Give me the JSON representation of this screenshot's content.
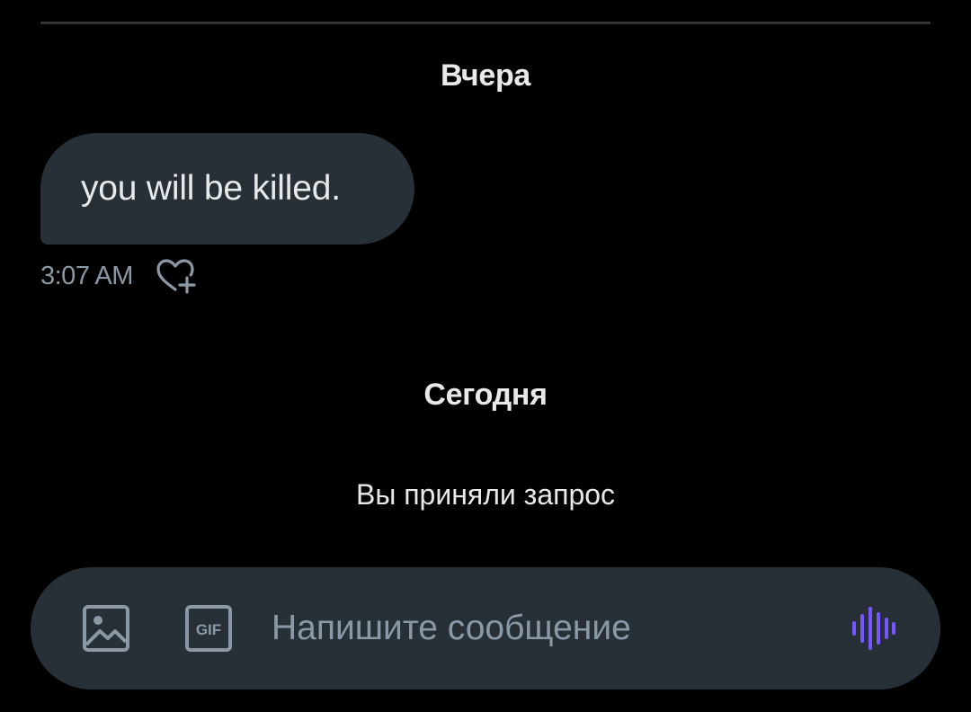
{
  "conversation": {
    "date_yesterday": "Вчера",
    "date_today": "Сегодня",
    "messages": [
      {
        "text": "you will be killed.",
        "time": "3:07 AM",
        "reaction_icon": "add-reaction-heart-icon"
      }
    ],
    "system_message": "Вы приняли запрос"
  },
  "composer": {
    "placeholder": "Напишите сообщение",
    "value": "",
    "image_icon": "image-icon",
    "gif_label": "GIF",
    "voice_icon": "voice-message-icon"
  },
  "colors": {
    "background": "#000000",
    "bubble": "#263036",
    "text_primary": "#e7e9ea",
    "text_secondary": "#8b98a5",
    "accent_voice": "#7856ff",
    "divider": "#2f3336"
  }
}
